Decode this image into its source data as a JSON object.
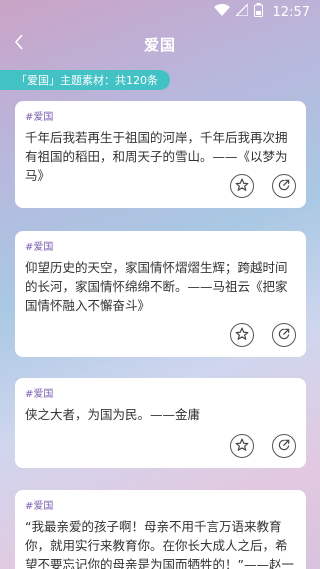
{
  "status_bar": {
    "time": "12:57",
    "icons": [
      "wifi-icon",
      "signal-icon",
      "battery-icon"
    ]
  },
  "nav": {
    "back_icon": "chevron-left-icon",
    "title": "爱国"
  },
  "category": {
    "label": "「爱国」主题素材：共120条"
  },
  "cards": [
    {
      "tag": "#爱国",
      "text": "千年后我若再生于祖国的河岸，千年后我再次拥有祖国的稻田，和周天子的雪山。——《以梦为马》"
    },
    {
      "tag": "#爱国",
      "text": "仰望历史的天空，家国情怀熠熠生辉；跨越时间的长河，家国情怀绵绵不断。——马祖云《把家国情怀融入不懈奋斗》"
    },
    {
      "tag": "#爱国",
      "text": "侠之大者，为国为民。——金庸"
    },
    {
      "tag": "#爱国",
      "text": "“我最亲爱的孩子啊！母亲不用千言万语来教育你，就用实行来教育你。在你长大成人之后，希望不要忘记你的母亲是为国而牺牲的！”——赵一曼"
    }
  ],
  "actions": {
    "favorite_icon": "star-icon",
    "share_icon": "share-icon"
  },
  "colors": {
    "accent": "#42c2c5",
    "tag": "#7a5fb0"
  }
}
